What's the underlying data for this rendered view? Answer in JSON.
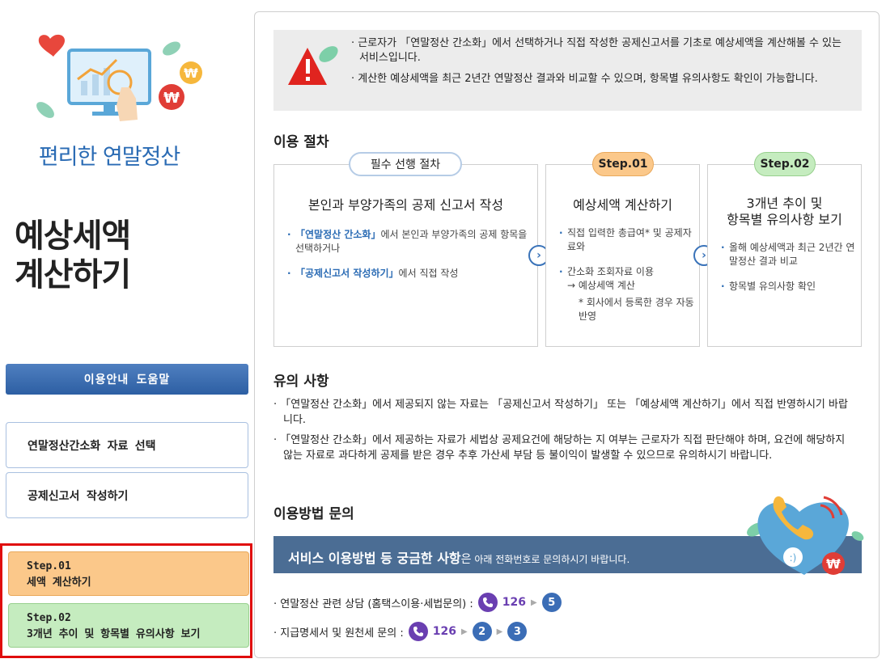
{
  "sidebar": {
    "hero_caption": "편리한 연말정산",
    "title_line1": "예상세액",
    "title_line2": "계산하기",
    "help_button": "이용안내 도움말",
    "links": [
      {
        "label": "연말정산간소화 자료 선택"
      },
      {
        "label": "공제신고서 작성하기"
      }
    ],
    "steps": [
      {
        "step": "Step.01",
        "label": "세액 계산하기"
      },
      {
        "step": "Step.02",
        "label": "3개년 추이 및 항목별 유의사항 보기"
      }
    ]
  },
  "notice": {
    "line1": "· 근로자가 「연말정산 간소화」에서 선택하거나 직접 작성한 공제신고서를 기초로 예상세액을 계산해볼 수 있는 서비스입니다.",
    "line2": "· 계산한 예상세액을 최근 2년간 연말정산 결과와 비교할 수 있으며, 항목별 유의사항도 확인이 가능합니다."
  },
  "procedure": {
    "title": "이용 절차",
    "box1": {
      "pill": "필수 선행 절차",
      "head": "본인과 부양가족의 공제 신고서 작성",
      "item1_link": "「연말정산 간소화」",
      "item1_text": "에서 본인과 부양가족의 공제 항목을 선택하거나",
      "item2_link": "「공제신고서 작성하기」",
      "item2_text": "에서 직접 작성"
    },
    "box2": {
      "pill": "Step.01",
      "head": "예상세액 계산하기",
      "item1": "직접 입력한 총급여* 및 공제자료와",
      "item2a": "간소화 조회자료 이용",
      "item2b": "→ 예상세액 계산",
      "item2c": "* 회사에서 등록한 경우 자동반영"
    },
    "box3": {
      "pill": "Step.02",
      "head_line1": "3개년 추이 및",
      "head_line2": "항목별 유의사항 보기",
      "item1": "올해 예상세액과 최근 2년간 연말정산 결과 비교",
      "item2": "항목별 유의사항 확인"
    }
  },
  "caution": {
    "title": "유의 사항",
    "line1": "· 「연말정산 간소화」에서 제공되지 않는 자료는 「공제신고서 작성하기」 또는 「예상세액 계산하기」에서 직접 반영하시기 바랍니다.",
    "line2": "· 「연말정산 간소화」에서 제공하는 자료가 세법상 공제요건에 해당하는 지 여부는 근로자가 직접 판단해야 하며, 요건에 해당하지 않는 자료로 과다하게 공제를 받은 경우 추후 가산세 부담 등 불이익이 발생할 수 있으므로 유의하시기 바랍니다."
  },
  "inquiry": {
    "title": "이용방법 문의",
    "banner_bold": "서비스 이용방법 등 궁금한 사항",
    "banner_normal": "은",
    "banner_small": " 아래 전화번호로 문의하시기 바랍니다.",
    "contact1_label": "· 연말정산 관련 상담 (홈택스이용·세법문의) :",
    "contact1_number": "126",
    "contact1_ext": "5",
    "contact2_label": "· 지급명세서 및 원천세 문의 :",
    "contact2_number": "126",
    "contact2_ext1": "2",
    "contact2_ext2": "3"
  }
}
